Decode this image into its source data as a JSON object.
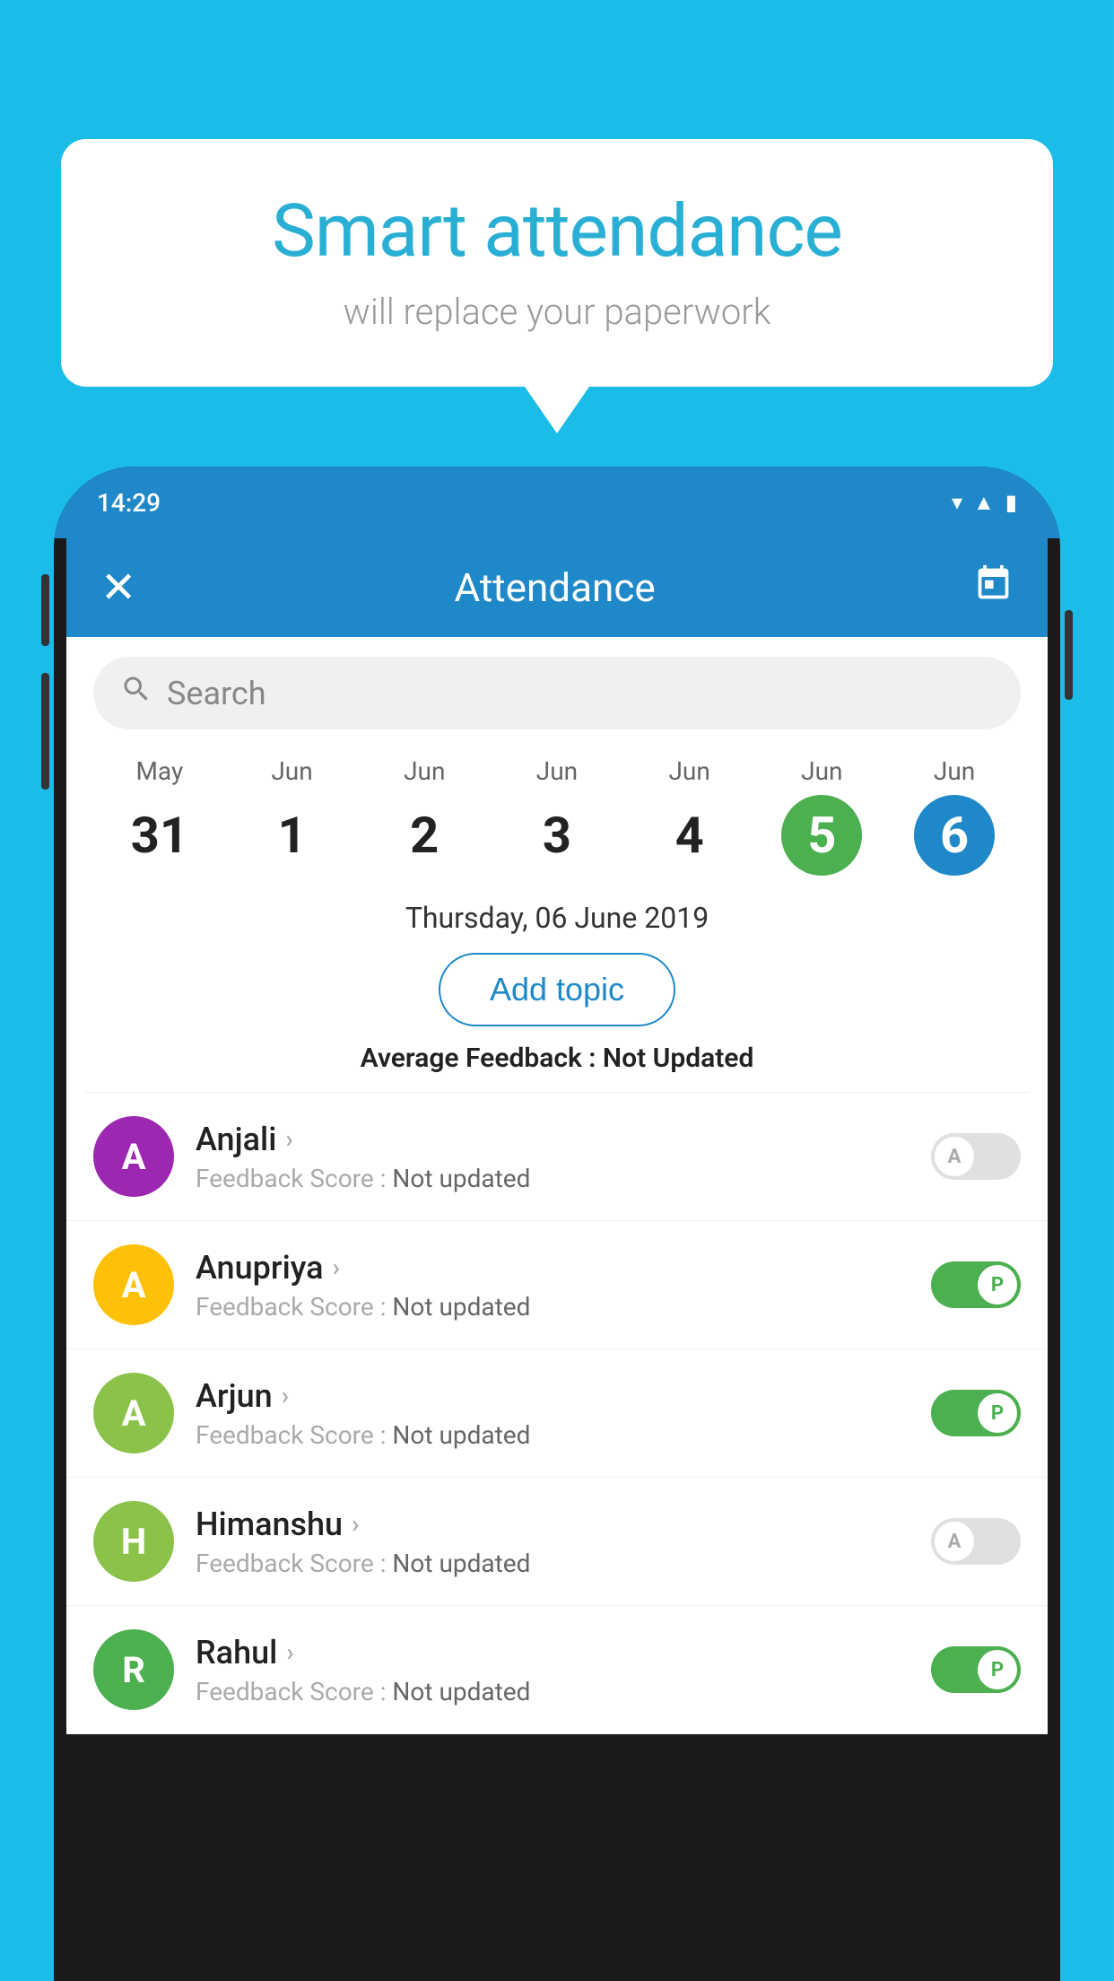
{
  "background_color": "#1bbde8",
  "speech_bubble": {
    "title": "Smart attendance",
    "subtitle": "will replace your paperwork"
  },
  "status_bar": {
    "time": "14:29",
    "wifi_icon": "▾",
    "signal_icon": "▲",
    "battery_icon": "▮"
  },
  "app_header": {
    "title": "Attendance",
    "close_icon": "✕",
    "calendar_icon": "📅"
  },
  "search": {
    "placeholder": "Search"
  },
  "calendar": {
    "days": [
      {
        "month": "May",
        "date": "31",
        "selected": null
      },
      {
        "month": "Jun",
        "date": "1",
        "selected": null
      },
      {
        "month": "Jun",
        "date": "2",
        "selected": null
      },
      {
        "month": "Jun",
        "date": "3",
        "selected": null
      },
      {
        "month": "Jun",
        "date": "4",
        "selected": null
      },
      {
        "month": "Jun",
        "date": "5",
        "selected": "green"
      },
      {
        "month": "Jun",
        "date": "6",
        "selected": "blue"
      }
    ]
  },
  "date_label": "Thursday, 06 June 2019",
  "add_topic_label": "Add topic",
  "avg_feedback_label": "Average Feedback :",
  "avg_feedback_value": "Not Updated",
  "students": [
    {
      "name": "Anjali",
      "initial": "A",
      "avatar_color": "#9c27b0",
      "feedback_label": "Feedback Score :",
      "feedback_value": "Not updated",
      "attendance": "absent",
      "toggle_label": "A"
    },
    {
      "name": "Anupriya",
      "initial": "A",
      "avatar_color": "#ffc107",
      "feedback_label": "Feedback Score :",
      "feedback_value": "Not updated",
      "attendance": "present",
      "toggle_label": "P"
    },
    {
      "name": "Arjun",
      "initial": "A",
      "avatar_color": "#8bc34a",
      "feedback_label": "Feedback Score :",
      "feedback_value": "Not updated",
      "attendance": "present",
      "toggle_label": "P"
    },
    {
      "name": "Himanshu",
      "initial": "H",
      "avatar_color": "#8bc34a",
      "feedback_label": "Feedback Score :",
      "feedback_value": "Not updated",
      "attendance": "absent",
      "toggle_label": "A"
    },
    {
      "name": "Rahul",
      "initial": "R",
      "avatar_color": "#4caf50",
      "feedback_label": "Feedback Score :",
      "feedback_value": "Not updated",
      "attendance": "present",
      "toggle_label": "P"
    }
  ]
}
